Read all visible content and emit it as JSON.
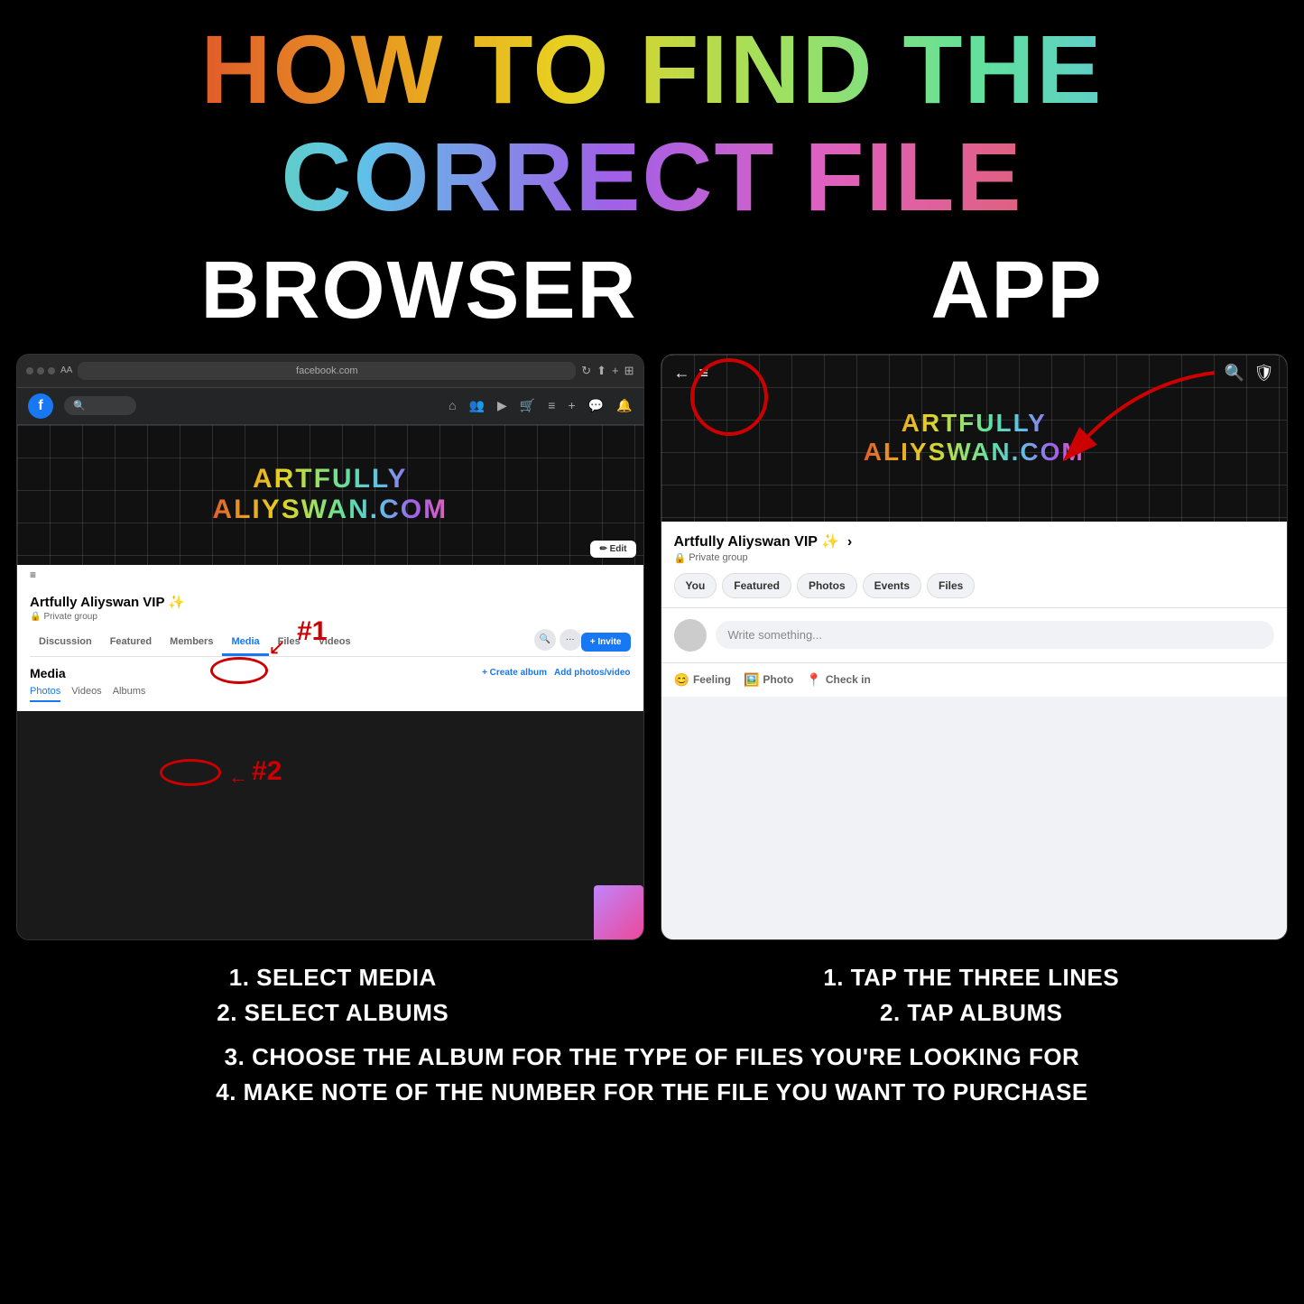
{
  "page": {
    "background": "#000000",
    "title": "HOW TO FIND THE CORRECT FILE"
  },
  "header": {
    "main_title": "HOW TO FIND THE CORRECT FILE"
  },
  "sections": {
    "browser_label": "BROWSER",
    "app_label": "APP"
  },
  "browser": {
    "url": "facebook.com",
    "fb_search_placeholder": "🔍",
    "cover_line1": "ARTFULLY",
    "cover_line2": "ALIYSWAN.COM",
    "group_name": "Artfully Aliyswan VIP ✨",
    "group_privacy": "Private group",
    "tabs": [
      "Discussion",
      "Featured",
      "Members",
      "Media",
      "Files",
      "Videos"
    ],
    "active_tab": "Media",
    "invite_label": "+ Invite",
    "media_title": "Media",
    "create_album": "+ Create album",
    "add_photos": "Add photos/video",
    "sub_tabs": [
      "Photos",
      "Videos",
      "Albums"
    ],
    "active_sub_tab": "Photos",
    "annotation_1": "#1",
    "annotation_2": "#2"
  },
  "app": {
    "nav_back": "←",
    "nav_menu": "≡",
    "nav_title_line1": "ARTFULLY",
    "nav_title_line2": "ALIYSWAN.COM",
    "group_name": "Artfully Aliyswan VIP ✨",
    "group_privacy_arrow": ">",
    "group_privacy": "Private group",
    "tabs": [
      "You",
      "Featured",
      "Photos",
      "Events",
      "Files"
    ],
    "write_placeholder": "Write something...",
    "actions": [
      "Feeling",
      "Photo",
      "Check in"
    ],
    "action_icons": [
      "😊",
      "🖼️",
      "📍"
    ]
  },
  "instructions": {
    "browser_steps": [
      "1. SELECT MEDIA",
      "2. SELECT ALBUMS",
      "3. CHOOSE THE ALBUM FOR THE TYPE OF FILES YOU'RE LOOKING FOR",
      "4. MAKE NOTE OF THE NUMBER FOR THE FILE YOU WANT TO PURCHASE"
    ],
    "app_steps": [
      "1. TAP THE THREE LINES",
      "2. TAP ALBUMS"
    ],
    "combined_line3": "3. CHOOSE THE ALBUM FOR THE TYPE OF FILES YOU'RE LOOKING FOR",
    "combined_line4": "4. MAKE NOTE OF THE NUMBER FOR THE FILE YOU WANT TO PURCHASE"
  }
}
